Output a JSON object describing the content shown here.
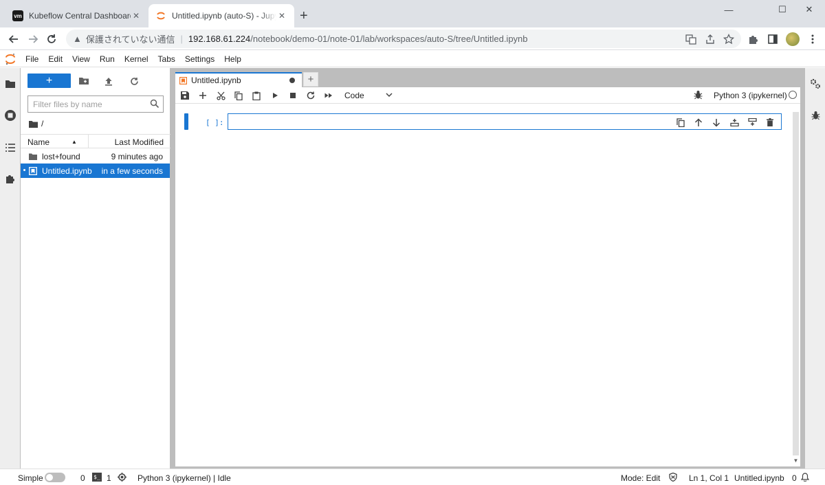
{
  "browser": {
    "tabs": [
      {
        "title": "Kubeflow Central Dashboard",
        "favicon": "vm"
      },
      {
        "title": "Untitled.ipynb (auto-S) - Jupyter"
      }
    ],
    "new_tab": "+",
    "window_controls": {
      "minimize": "—",
      "restore": "☐",
      "close": "✕"
    },
    "address": {
      "warning_icon": "▲",
      "insecure_label": "保護されていない通信",
      "host": "192.168.61.224",
      "path": "/notebook/demo-01/note-01/lab/workspaces/auto-S/tree/Untitled.ipynb"
    }
  },
  "menubar": {
    "items": [
      "File",
      "Edit",
      "View",
      "Run",
      "Kernel",
      "Tabs",
      "Settings",
      "Help"
    ]
  },
  "filebrowser": {
    "new_label": "+",
    "filter_placeholder": "Filter files by name",
    "breadcrumb": "/",
    "columns": {
      "name": "Name",
      "modified": "Last Modified"
    },
    "rows": [
      {
        "name": "lost+found",
        "modified": "9 minutes ago",
        "type": "folder"
      },
      {
        "name": "Untitled.ipynb",
        "modified": "in a few seconds",
        "type": "notebook"
      }
    ]
  },
  "notebook": {
    "tab_title": "Untitled.ipynb",
    "add_tab": "+",
    "cell_type": "Code",
    "kernel_name": "Python 3 (ipykernel)",
    "cell_prompt": "[ ]:"
  },
  "statusbar": {
    "simple_label": "Simple",
    "terminals_count": "0",
    "terminal_icon_text": "$_",
    "kernels_count": "1",
    "kernel_status": "Python 3 (ipykernel) | Idle",
    "mode": "Mode: Edit",
    "cursor": "Ln 1, Col 1",
    "filename": "Untitled.ipynb",
    "notifications": "0"
  },
  "colors": {
    "accent": "#1976d2",
    "jupyter_orange": "#f37726"
  }
}
